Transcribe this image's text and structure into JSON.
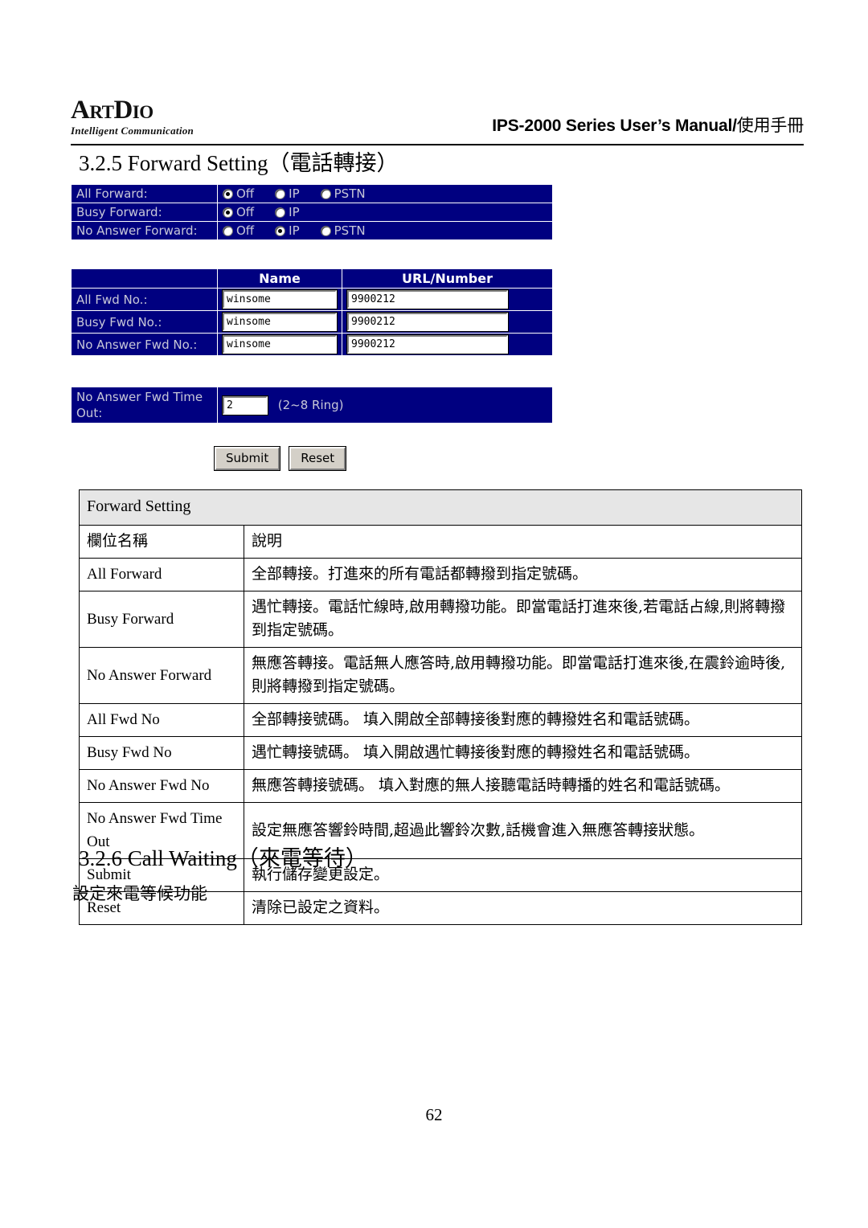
{
  "header": {
    "logo_primary": "ArtDio",
    "logo_tagline": "Intelligent Communication",
    "doc_title_en": "IPS-2000 Series User’s Manual/",
    "doc_title_cjk": "使用手冊"
  },
  "sections": {
    "forward_setting_heading": "3.2.5 Forward Setting（電話轉接）",
    "call_waiting_heading": "3.2.6 Call Waiting（來電等待）",
    "call_waiting_body": "設定來電等候功能"
  },
  "forward_form": {
    "mode_rows": [
      {
        "label": "All Forward:",
        "options": [
          {
            "label": "Off",
            "selected": true
          },
          {
            "label": "IP",
            "selected": false
          },
          {
            "label": "PSTN",
            "selected": false
          }
        ]
      },
      {
        "label": "Busy Forward:",
        "options": [
          {
            "label": "Off",
            "selected": true
          },
          {
            "label": "IP",
            "selected": false
          }
        ]
      },
      {
        "label": "No Answer Forward:",
        "options": [
          {
            "label": "Off",
            "selected": false
          },
          {
            "label": "IP",
            "selected": true
          },
          {
            "label": "PSTN",
            "selected": false
          }
        ]
      }
    ],
    "number_table": {
      "headers": [
        "",
        "Name",
        "URL/Number"
      ],
      "rows": [
        {
          "label": "All Fwd No.:",
          "name": "winsome",
          "url": "9900212"
        },
        {
          "label": "Busy Fwd No.:",
          "name": "winsome",
          "url": "9900212"
        },
        {
          "label": "No Answer Fwd No.:",
          "name": "winsome",
          "url": "9900212"
        }
      ]
    },
    "timeout": {
      "label": "No Answer Fwd Time Out:",
      "value": "2",
      "hint": "(2~8 Ring)"
    },
    "buttons": {
      "submit": "Submit",
      "reset": "Reset"
    }
  },
  "description_table": {
    "title": "Forward Setting",
    "column_headers": [
      "欄位名稱",
      "說明"
    ],
    "rows": [
      {
        "term": "All Forward",
        "desc": "全部轉接。打進來的所有電話都轉撥到指定號碼。"
      },
      {
        "term": "Busy Forward",
        "desc": "遇忙轉接。電話忙線時,啟用轉撥功能。即當電話打進來後,若電話占線,則將轉撥到指定號碼。"
      },
      {
        "term": "No Answer Forward",
        "desc": "無應答轉接。電話無人應答時,啟用轉撥功能。即當電話打進來後,在震鈴逾時後,則將轉撥到指定號碼。"
      },
      {
        "term": "All Fwd No",
        "desc": "全部轉接號碼。 填入開啟全部轉接後對應的轉撥姓名和電話號碼。"
      },
      {
        "term": "Busy Fwd No",
        "desc": "遇忙轉接號碼。 填入開啟遇忙轉接後對應的轉撥姓名和電話號碼。"
      },
      {
        "term": "No Answer Fwd No",
        "desc": "無應答轉接號碼。 填入對應的無人接聽電話時轉播的姓名和電話號碼。"
      },
      {
        "term": "No Answer Fwd Time Out",
        "desc": "設定無應答響鈴時間,超過此響鈴次數,話機會進入無應答轉接狀態。"
      },
      {
        "term": "Submit",
        "desc": "執行儲存變更設定。"
      },
      {
        "term": "Reset",
        "desc": "清除已設定之資料。"
      }
    ]
  },
  "footer": {
    "page_number": "62"
  },
  "colors": {
    "table_blue": "#000080",
    "label_text": "#c8c8d8",
    "title_row_bg": "#e6e6e6"
  }
}
